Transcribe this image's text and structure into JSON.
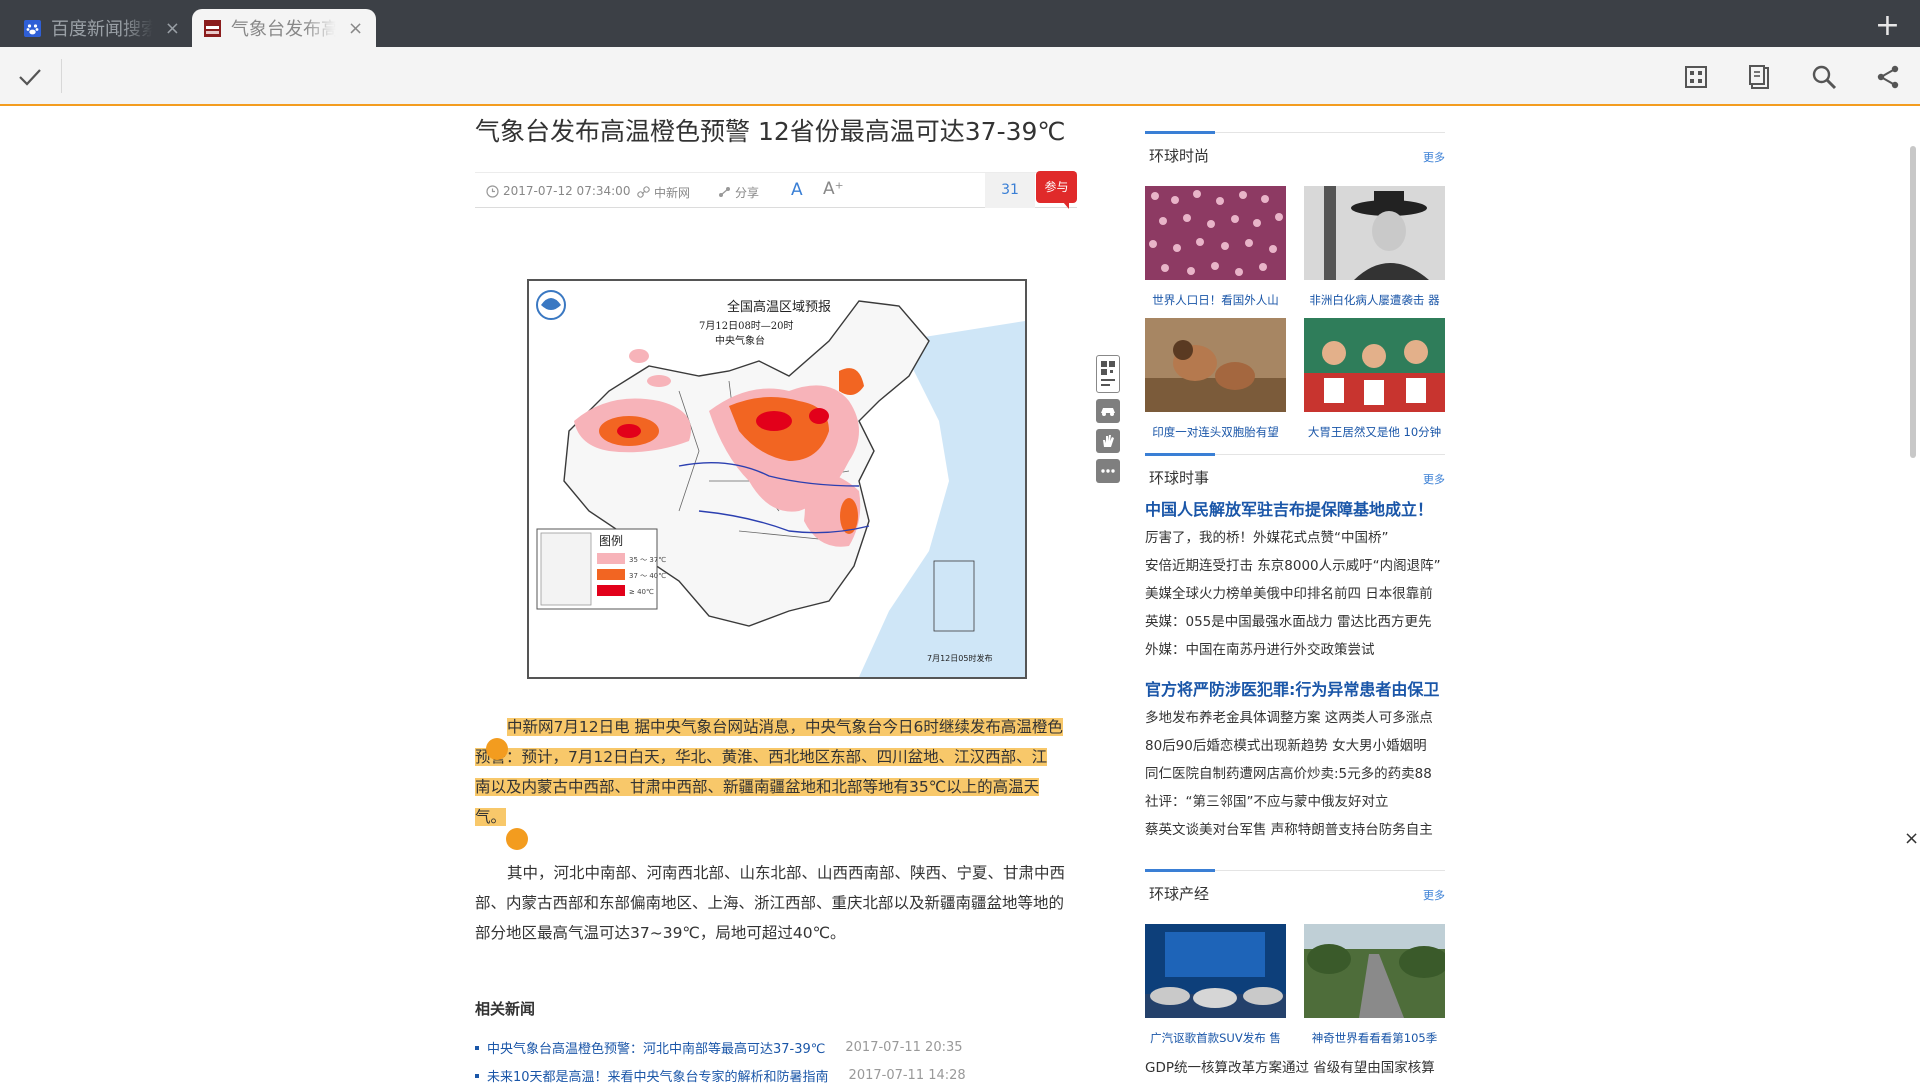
{
  "tabs": [
    {
      "label": "百度新闻搜索",
      "active": false
    },
    {
      "label": "气象台发布高温橙色预警",
      "active": true
    }
  ],
  "tab_close": "×",
  "new_tab": "+",
  "toolbar": {
    "icons": [
      "check-icon",
      "grid-icon",
      "clipboard-icon",
      "search-icon",
      "share-icon"
    ]
  },
  "article": {
    "title": "气象台发布高温橙色预警 12省份最高温可达37-39℃",
    "date": "2017-07-12 07:34:00",
    "source": "中新网",
    "share": "分享",
    "font_small": "A",
    "font_large": "A⁺",
    "comment_count": "31",
    "join": "参与",
    "map": {
      "title": "全国高温区域预报",
      "time": "7月12日08时—20时",
      "agency": "中央气象台",
      "legend_title": "图例",
      "legend": [
        {
          "label": "35 ～ 37℃",
          "color": "#f7b3b9"
        },
        {
          "label": "37 ～ 40℃",
          "color": "#f26522"
        },
        {
          "label": "≥ 40℃",
          "color": "#e2001a"
        }
      ],
      "stamp": "7月12日05时发布"
    },
    "p1_highlight_a": "中新网7月12日电 据中央气象台网站消息，中央气象台今日6时继续发布高温橙色",
    "p1_highlight_b": "预警：预计，7月12日白天，华北、黄淮、西北地区东部、四川盆地、江汉西部、江",
    "p1_highlight_c": "南以及内蒙古中西部、甘肃中西部、新疆南疆盆地和北部等地有35℃以上的高温天",
    "p1_highlight_d": "气。",
    "p2": "其中，河北中南部、河南西北部、山东北部、山西西南部、陕西、宁夏、甘肃中西部、内蒙古西部和东部偏南地区、上海、浙江西部、重庆北部以及新疆南疆盆地等地的部分地区最高气温可达37~39℃，局地可超过40℃。",
    "related_title": "相关新闻",
    "related": [
      {
        "title": "中央气象台高温橙色预警：河北中南部等最高可达37-39℃",
        "date": "2017-07-11 20:35"
      },
      {
        "title": "未来10天都是高温！来看中央气象台专家的解析和防暑指南",
        "date": "2017-07-11 14:28"
      }
    ]
  },
  "sidebar": {
    "fashion": {
      "title": "环球时尚",
      "more": "更多",
      "items": [
        {
          "caption": "世界人口日！看国外人山"
        },
        {
          "caption": "非洲白化病人屡遭袭击 器"
        },
        {
          "caption": "印度一对连头双胞胎有望"
        },
        {
          "caption": "大胃王居然又是他 10分钟"
        }
      ]
    },
    "news": {
      "title": "环球时事",
      "more": "更多",
      "headline1": "中国人民解放军驻吉布提保障基地成立！",
      "list1": [
        "厉害了，我的桥！外媒花式点赞“中国桥”",
        "安倍近期连受打击 东京8000人示威吁“内阁退阵”",
        "美媒全球火力榜单美俄中印排名前四 日本很靠前",
        "英媒：055是中国最强水面战力 雷达比西方更先",
        "外媒：中国在南苏丹进行外交政策尝试"
      ],
      "headline2": "官方将严防涉医犯罪:行为异常患者由保卫",
      "list2": [
        "多地发布养老金具体调整方案 这两类人可多涨点",
        "80后90后婚恋模式出现新趋势 女大男小婚姻明",
        "同仁医院自制药遭网店高价炒卖:5元多的药卖88",
        "社评：“第三邻国”不应与蒙中俄友好对立",
        "蔡英文谈美对台军售 声称特朗普支持台防务自主"
      ]
    },
    "finance": {
      "title": "环球产经",
      "more": "更多",
      "items": [
        {
          "caption": "广汽讴歌首款SUV发布 售"
        },
        {
          "caption": "神奇世界看看看第105季"
        }
      ],
      "list": [
        "GDP统一核算改革方案通过 省级有望由国家核算"
      ]
    }
  },
  "close_label": "×"
}
